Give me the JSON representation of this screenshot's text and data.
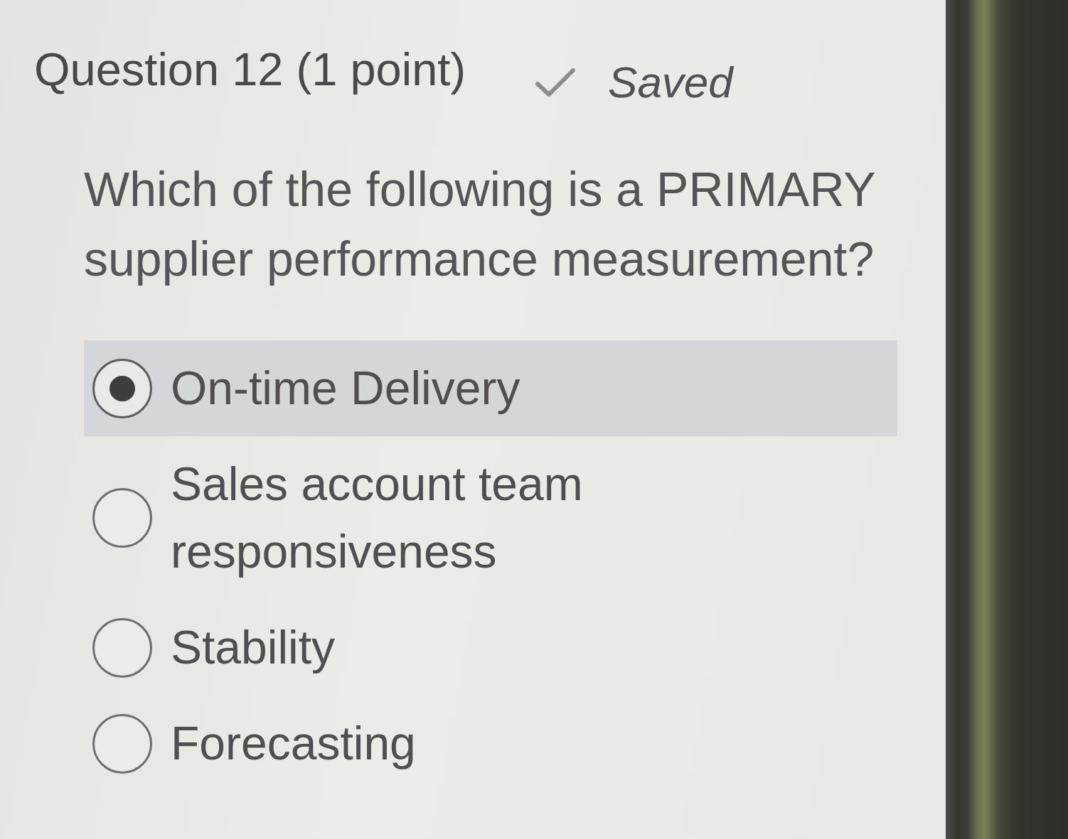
{
  "question": {
    "title": "Question 12 (1 point)",
    "status": {
      "kind": "saved",
      "label": "Saved"
    },
    "prompt": "Which of the following is a PRIMARY supplier performance measurement?",
    "options": [
      {
        "label": "On-time Delivery",
        "selected": true
      },
      {
        "label": "Sales account team responsiveness",
        "selected": false
      },
      {
        "label": "Stability",
        "selected": false
      },
      {
        "label": "Forecasting",
        "selected": false
      }
    ]
  }
}
